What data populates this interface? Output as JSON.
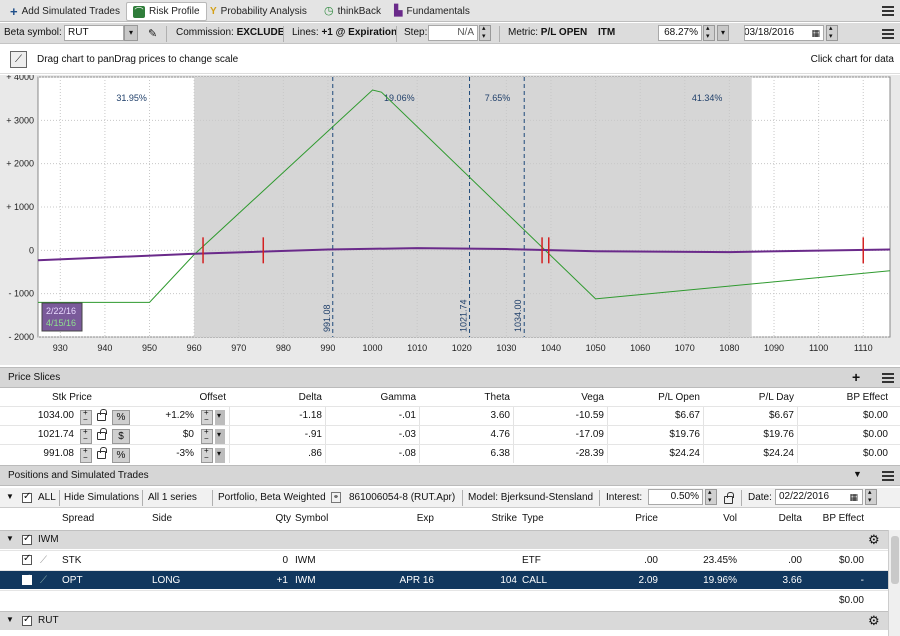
{
  "tabs": [
    {
      "label": "Add Simulated Trades"
    },
    {
      "label": "Risk Profile"
    },
    {
      "label": "Probability Analysis"
    },
    {
      "label": "thinkBack"
    },
    {
      "label": "Fundamentals"
    }
  ],
  "controls": {
    "beta_label": "Beta symbol:",
    "beta_value": "RUT",
    "commission_label": "Commission:",
    "commission_value": "EXCLUDE",
    "lines_label": "Lines:",
    "lines_value": "+1 @ Expiration",
    "step_label": "Step:",
    "step_value": "N/A",
    "metric_label": "Metric:",
    "metric_value": "P/L OPEN",
    "itm_label": "ITM",
    "itm_value": "68.27%",
    "date_value": "03/18/2016"
  },
  "info": {
    "left": "Drag chart to panDrag prices to change scale",
    "right": "Click chart for data"
  },
  "chart_data": {
    "type": "line",
    "xlim": [
      925,
      1116
    ],
    "ylim": [
      -2000,
      4000
    ],
    "x_ticks": [
      930,
      940,
      950,
      960,
      970,
      980,
      990,
      1000,
      1010,
      1020,
      1030,
      1040,
      1050,
      1060,
      1070,
      1080,
      1090,
      1100,
      1110
    ],
    "y_ticks": [
      {
        "v": 4000,
        "label": "+ 4000"
      },
      {
        "v": 3000,
        "label": "+ 3000"
      },
      {
        "v": 2000,
        "label": "+ 2000"
      },
      {
        "v": 1000,
        "label": "+ 1000"
      },
      {
        "v": 0,
        "label": "0"
      },
      {
        "v": -1000,
        "label": "- 1000"
      },
      {
        "v": -2000,
        "label": "- 2000"
      }
    ],
    "shaded_range": [
      960,
      1085
    ],
    "price_lines": [
      {
        "x": 991.08,
        "label": "991.08"
      },
      {
        "x": 1021.74,
        "label": "1021.74"
      },
      {
        "x": 1034.0,
        "label": "1034.00"
      }
    ],
    "probabilities": [
      {
        "x": 946,
        "label": "31.95%"
      },
      {
        "x": 1006,
        "label": "19.06%"
      },
      {
        "x": 1028,
        "label": "7.65%"
      },
      {
        "x": 1075,
        "label": "41.34%"
      }
    ],
    "markers": [
      962,
      975.5,
      1038,
      1039.5,
      1110
    ],
    "series": [
      {
        "name": "4/15/16",
        "color": "#2f9a2f",
        "x": [
          925,
          950,
          960,
          1000,
          1002,
          1050,
          1116
        ],
        "y": [
          -1200,
          -1200,
          -100,
          3700,
          3650,
          -1120,
          -470
        ]
      },
      {
        "name": "2/22/16",
        "color": "#6a2a8a",
        "x": [
          925,
          960,
          990,
          1010,
          1030,
          1050,
          1080,
          1116
        ],
        "y": [
          -230,
          -80,
          20,
          50,
          30,
          -20,
          -40,
          20
        ]
      }
    ],
    "legend": [
      "2/22/16",
      "4/15/16"
    ]
  },
  "price_slices": {
    "title": "Price Slices",
    "headers": [
      "Stk Price",
      "Offset",
      "Delta",
      "Gamma",
      "Theta",
      "Vega",
      "P/L Open",
      "P/L Day",
      "BP Effect"
    ],
    "rows": [
      {
        "price": "1034.00",
        "unit": "%",
        "offset": "+1.2%",
        "delta": "-1.18",
        "gamma": "-.01",
        "theta": "3.60",
        "vega": "-10.59",
        "pl_open": "$6.67",
        "pl_day": "$6.67",
        "bp": "$0.00"
      },
      {
        "price": "1021.74",
        "unit": "$",
        "offset": "$0",
        "delta": "-.91",
        "gamma": "-.03",
        "theta": "4.76",
        "vega": "-17.09",
        "pl_open": "$19.76",
        "pl_day": "$19.76",
        "bp": "$0.00"
      },
      {
        "price": "991.08",
        "unit": "%",
        "offset": "-3%",
        "delta": ".86",
        "gamma": "-.08",
        "theta": "6.38",
        "vega": "-28.39",
        "pl_open": "$24.24",
        "pl_day": "$24.24",
        "bp": "$0.00"
      }
    ]
  },
  "positions": {
    "title": "Positions and Simulated Trades",
    "toolbar": {
      "all": "ALL",
      "hide": "Hide Simulations",
      "series": "All 1 series",
      "portfolio": "Portfolio, Beta Weighted",
      "account": "861006054-8 (RUT.Apr)",
      "model": "Model: Bjerksund-Stensland",
      "interest_label": "Interest:",
      "interest_value": "0.50%",
      "date_label": "Date:",
      "date_value": "02/22/2016"
    },
    "headers": [
      "Spread",
      "Side",
      "Qty",
      "Symbol",
      "Exp",
      "Strike",
      "Type",
      "Price",
      "Vol",
      "Delta",
      "BP Effect"
    ],
    "groups": [
      {
        "name": "IWM"
      },
      {
        "name": "RUT"
      }
    ],
    "rows": [
      {
        "spread": "STK",
        "side": "",
        "qty": "0",
        "symbol": "IWM",
        "exp": "",
        "strike": "",
        "type": "ETF",
        "price": ".00",
        "vol": "23.45%",
        "delta": ".00",
        "bp": "$0.00"
      },
      {
        "spread": "OPT",
        "side": "LONG",
        "qty": "+1",
        "symbol": "IWM",
        "exp": "APR 16",
        "strike": "104",
        "type": "CALL",
        "price": "2.09",
        "vol": "19.96%",
        "delta": "3.66",
        "bp": "-"
      }
    ],
    "subtotal": "$0.00"
  },
  "colors": {
    "accent": "#11375e",
    "pl_line": "#2f9a2f",
    "today_line": "#6a2a8a"
  }
}
